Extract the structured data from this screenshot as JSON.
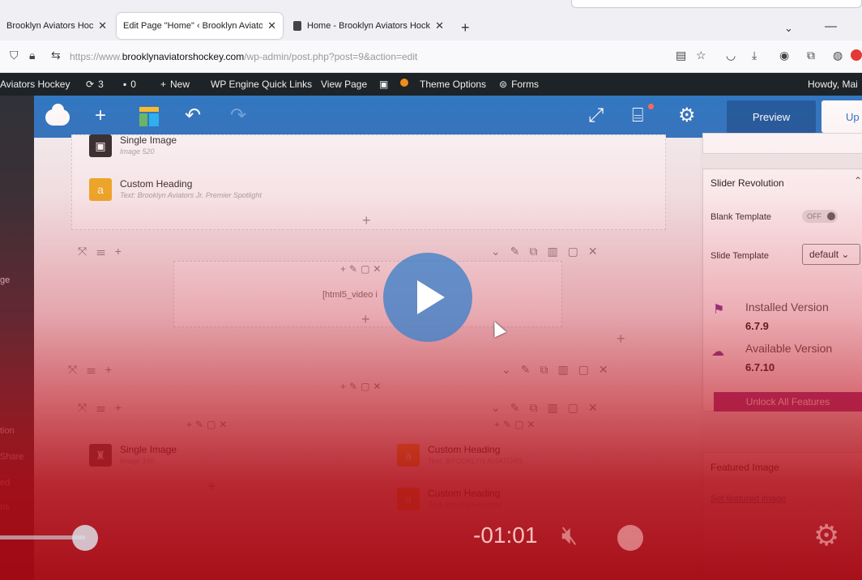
{
  "browser": {
    "tabs": [
      {
        "label": "Brooklyn Aviators Hock",
        "close": "✕"
      },
      {
        "label": "Edit Page \"Home\" ‹ Brooklyn Aviato",
        "close": "✕"
      },
      {
        "label": "Home - Brooklyn Aviators Hock",
        "close": "✕"
      }
    ],
    "new_tab": "+",
    "url_prefix": "https://www.",
    "url_domain": "brooklynaviatorshockey.com",
    "url_path": "/wp-admin/post.php?post=9&action=edit"
  },
  "admin_bar": {
    "site": "Aviators Hockey",
    "updates": "3",
    "comments": "0",
    "new": "New",
    "wp_engine": "WP Engine Quick Links",
    "view_page": "View Page",
    "theme_options": "Theme Options",
    "forms": "Forms",
    "howdy": "Howdy, Mai"
  },
  "left_menu": [
    "ge",
    "tion",
    "Share",
    "ed",
    "ns"
  ],
  "builder_bar": {
    "preview": "Preview",
    "update": "Up"
  },
  "canvas": {
    "elements": {
      "single_image_1": {
        "name": "Single Image",
        "sub": "Image 520"
      },
      "custom_heading_1": {
        "name": "Custom Heading",
        "sub": "Text: Brooklyn Aviators Jr. Premier Spotlight"
      },
      "shortcode": "[html5_video i",
      "single_image_2": {
        "name": "Single Image",
        "sub": "Image 160"
      },
      "custom_heading_2": {
        "name": "Custom Heading",
        "sub": "Text: BROOKLYN AVIATORS"
      },
      "custom_heading_3": {
        "name": "Custom Heading",
        "sub": "Text: Brooklyn Aviators"
      }
    }
  },
  "settings_panel": {
    "slider_title": "Slider Revolution",
    "blank_template_label": "Blank Template",
    "blank_template_value": "OFF",
    "slide_template_label": "Slide Template",
    "slide_template_value": "default",
    "installed_label": "Installed Version",
    "installed_value": "6.7.9",
    "available_label": "Available Version",
    "available_value": "6.7.10",
    "unlock_label": "Unlock All Features",
    "featured_title": "Featured Image",
    "featured_link": "Set featured image"
  },
  "video_player": {
    "time": "-01:01",
    "progress_fraction": 0.1
  },
  "colors": {
    "builder_blue": "#2f79c4",
    "admin_bar": "#1d2327",
    "overlay_red": "#b0101c",
    "unlock_purple": "#9a3b8f"
  }
}
